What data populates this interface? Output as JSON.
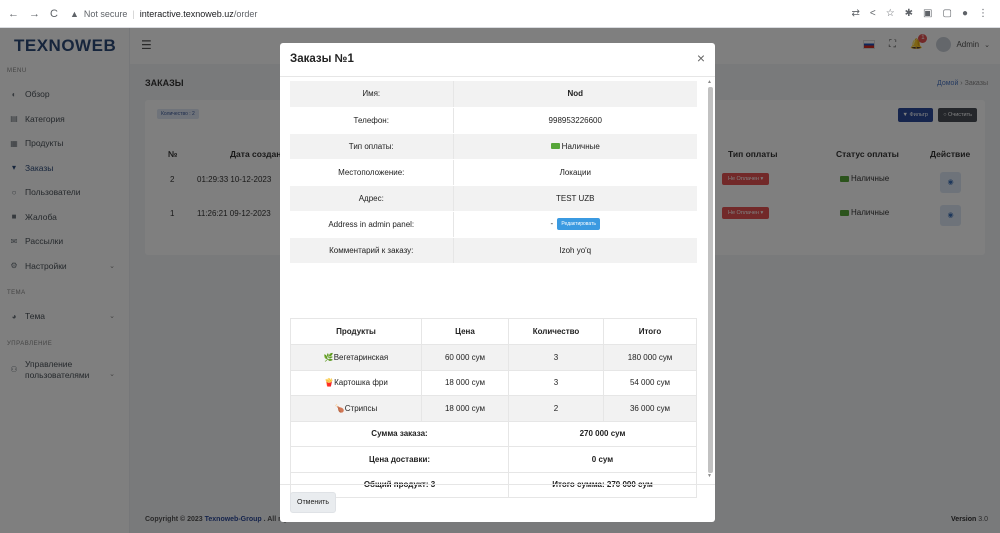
{
  "browser": {
    "security": "Not secure",
    "url_host": "interactive.texnoweb.uz",
    "url_path": "/order"
  },
  "sidebar": {
    "logo": "TEXNOWEB",
    "section_menu": "MENU",
    "items": [
      {
        "label": "Обзор",
        "icon": "dashboard-icon"
      },
      {
        "label": "Категория",
        "icon": "category-icon"
      },
      {
        "label": "Продукты",
        "icon": "grid-icon"
      },
      {
        "label": "Заказы",
        "icon": "cart-icon"
      },
      {
        "label": "Пользователи",
        "icon": "user-icon"
      },
      {
        "label": "Жалоба",
        "icon": "message-icon"
      },
      {
        "label": "Рассылки",
        "icon": "mail-icon"
      },
      {
        "label": "Настройки",
        "icon": "settings-icon"
      }
    ],
    "section_theme": "ТЕМА",
    "theme_item": "Тема",
    "section_manage": "УПРАВЛЕНИЕ",
    "manage_item_line1": "Управление",
    "manage_item_line2": "пользователями"
  },
  "topbar": {
    "notif_count": "1",
    "admin": "Admin"
  },
  "page": {
    "title": "ЗАКАЗЫ",
    "breadcrumb_home": "Домой",
    "breadcrumb_current": "Заказы",
    "qty_badge": "Количество : 2",
    "filter_btn": "Фильтр",
    "clear_btn": "Очистить",
    "columns": [
      "№",
      "Дата создан",
      "Тип оплаты",
      "Статус оплаты",
      "Действие"
    ],
    "rows": [
      {
        "num": "2",
        "date": "01:29:33 10-12-2023",
        "pay_status": "Не Оплачен",
        "pay_type": "Наличные"
      },
      {
        "num": "1",
        "date": "11:26:21 09-12-2023",
        "pay_status": "Не Оплачен",
        "pay_type": "Наличные"
      }
    ],
    "footer_prefix": "Copyright © 2023",
    "footer_brand": "Texnoweb-Group",
    "footer_suffix": ". All rights reserved.",
    "version_label": "Version",
    "version_value": "3.0"
  },
  "modal": {
    "title": "Заказы №1",
    "close": "×",
    "info": {
      "name_label": "Имя:",
      "name_value": "Nod",
      "phone_label": "Телефон:",
      "phone_value": "998953226600",
      "paytype_label": "Тип оплаты:",
      "paytype_value": "Наличные",
      "location_label": "Местоположение:",
      "location_value": "Локации",
      "address_label": "Адрес:",
      "address_value": "TEST UZB",
      "admin_addr_label": "Address in admin panel:",
      "admin_addr_value": "-",
      "edit_btn": "Редактировать",
      "comment_label": "Комментарий к заказу:",
      "comment_value": "Izoh yo'q"
    },
    "products": {
      "headers": [
        "Продукты",
        "Цена",
        "Количество",
        "Итого"
      ],
      "rows": [
        {
          "emoji": "🌿",
          "name": "Вегетаринская",
          "price": "60 000 сум",
          "qty": "3",
          "total": "180 000 сум"
        },
        {
          "emoji": "🍟",
          "name": "Картошка фри",
          "price": "18 000 сум",
          "qty": "3",
          "total": "54 000 сум"
        },
        {
          "emoji": "🍗",
          "name": "Стрипсы",
          "price": "18 000 сум",
          "qty": "2",
          "total": "36 000 сум"
        }
      ],
      "sum_label": "Сумма заказа:",
      "sum_value": "270 000 сум",
      "delivery_label": "Цена доставки:",
      "delivery_value": "0 сум",
      "total_products": "Общий продукт: 3",
      "grand_total": "Итого сумма: 270 000 сум"
    },
    "cancel_btn": "Отменить"
  }
}
